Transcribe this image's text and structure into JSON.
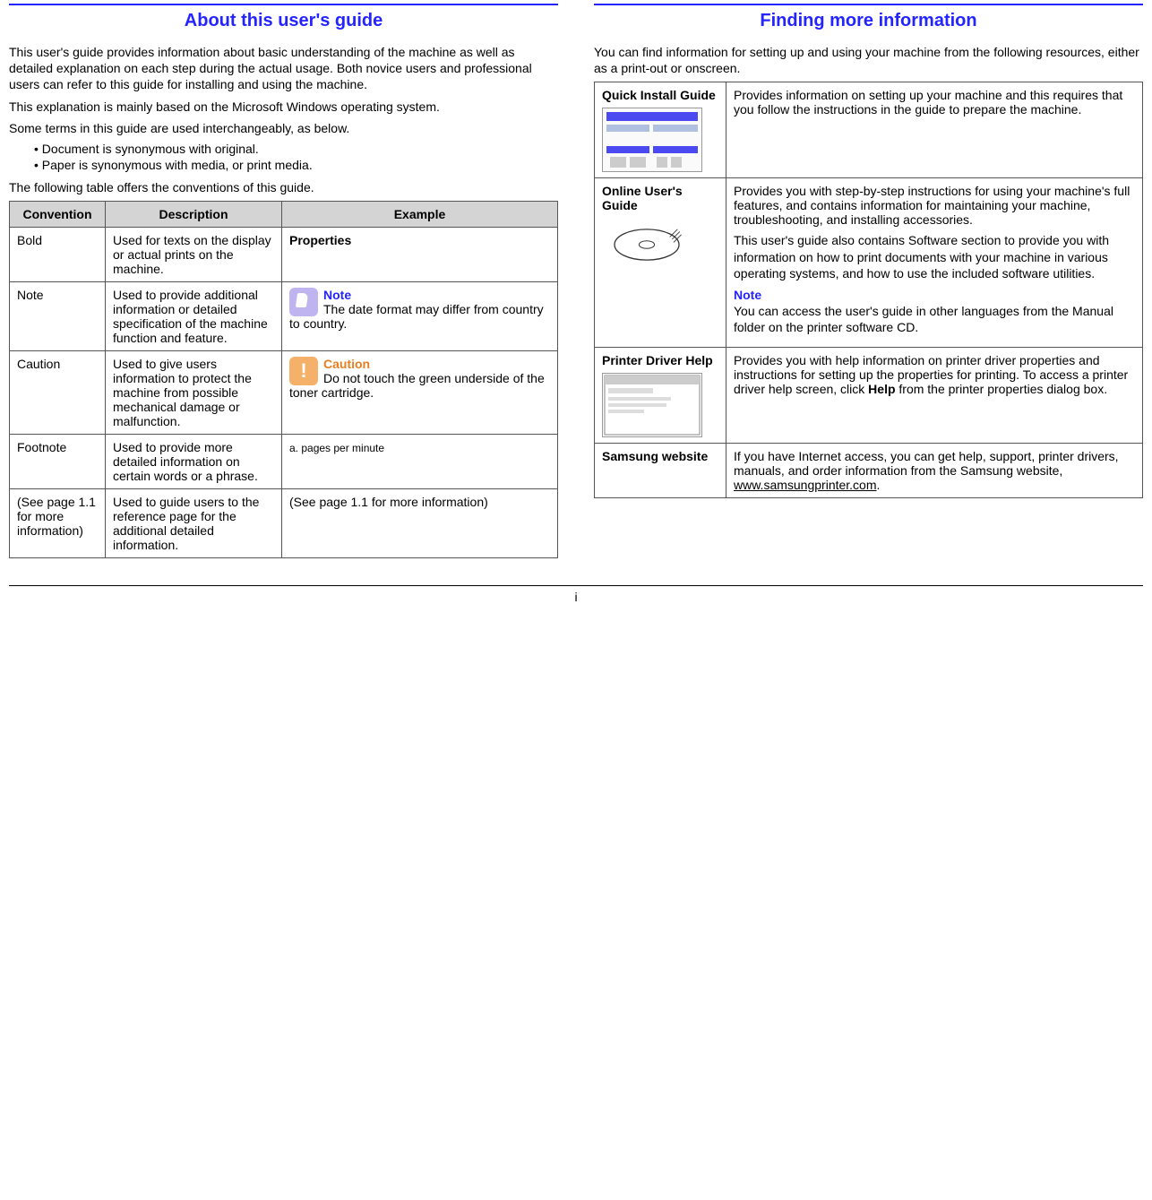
{
  "left": {
    "title": "About this user's guide",
    "p1": "This user's guide provides information about basic understanding of the machine as well as detailed explanation on each step during the actual usage. Both novice users and professional users can refer to this guide for installing and using the machine.",
    "p2": "This explanation is mainly based on the Microsoft Windows operating system.",
    "p3": "Some terms in this guide are used interchangeably, as below.",
    "bullets": [
      "Document is synonymous with original.",
      "Paper is synonymous with media, or print media."
    ],
    "p4": "The following table offers the conventions of this guide.",
    "th1": "Convention",
    "th2": "Description",
    "th3": "Example",
    "rows": [
      {
        "conv": "Bold",
        "desc": "Used for texts on the display or actual prints on the machine.",
        "ex_bold": "Properties"
      },
      {
        "conv": "Note",
        "desc": "Used to provide additional information or detailed specification of the machine function and feature.",
        "note_label": "Note",
        "note_text": "The date format may differ from country to country."
      },
      {
        "conv": "Caution",
        "desc": "Used to give users information to protect the machine from possible mechanical damage or malfunction.",
        "caution_label": "Caution",
        "caution_text": "Do not touch the green underside of the toner cartridge."
      },
      {
        "conv": "Footnote",
        "desc": "Used to provide more detailed information on certain words or a phrase.",
        "footnote_ex": "a. pages per minute"
      },
      {
        "conv": "(See page 1.1 for more information)",
        "desc": "Used to guide users to the reference page for the additional detailed information.",
        "crossref_ex": "(See page 1.1 for more information)"
      }
    ]
  },
  "right": {
    "title": "Finding more information",
    "intro": "You can find information for setting up and using your machine from the following resources, either as a print-out or onscreen.",
    "rows": [
      {
        "name": "Quick Install Guide",
        "desc": "Provides information on setting up your machine and this requires that you follow the instructions in the guide to prepare the machine."
      },
      {
        "name": "Online User's Guide",
        "desc1": "Provides you with step-by-step instructions for using your machine's full features, and contains information for maintaining your machine, troubleshooting, and installing accessories.",
        "desc2": "This user's guide also contains Software section to provide you with information on how to print documents with your machine in various operating systems, and how to use the included software utilities.",
        "note_label": "Note",
        "note_text": "You can access the user's guide in other languages from the Manual folder on the printer software CD."
      },
      {
        "name": "Printer Driver Help",
        "desc_a": "Provides you with help information on printer driver properties and instructions for setting up the properties for printing. To access a printer driver help screen, click ",
        "desc_bold": "Help",
        "desc_b": " from the printer properties dialog box."
      },
      {
        "name": "Samsung website",
        "desc_a": "If you have Internet access, you can get help, support, printer drivers, manuals, and order information from the Samsung website, ",
        "link": "www.samsungprinter.com",
        "desc_b": "."
      }
    ]
  },
  "page_number": "i"
}
